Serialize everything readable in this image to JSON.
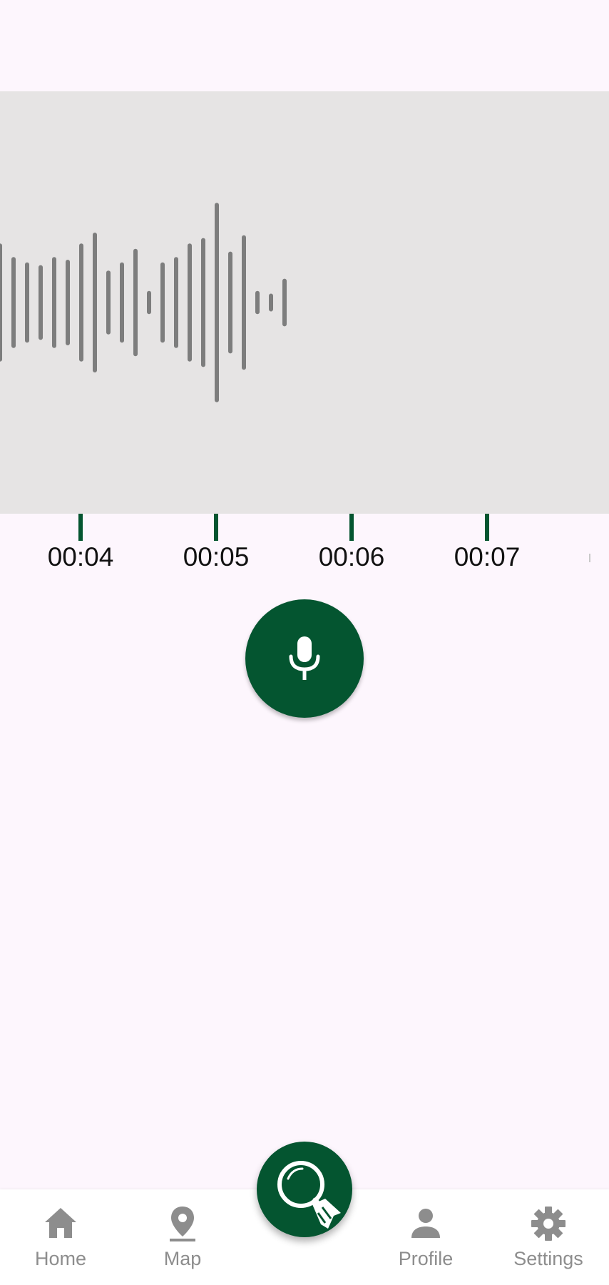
{
  "waveform": {
    "bar_color": "#7d7d7d",
    "background": "#e6e4e4",
    "amplitudes": [
      0.42,
      0.32,
      0.28,
      0.26,
      0.32,
      0.3,
      0.42,
      0.5,
      0.22,
      0.28,
      0.38,
      0.07,
      0.28,
      0.32,
      0.42,
      0.46,
      0.72,
      0.36,
      0.48,
      0.07,
      0.05,
      0.16
    ]
  },
  "timeline": {
    "accent": "#045530",
    "ticks": [
      {
        "label": "00:04"
      },
      {
        "label": "00:05"
      },
      {
        "label": "00:06"
      },
      {
        "label": "00:07"
      }
    ]
  },
  "record_button": {
    "icon": "microphone-icon",
    "color": "#045530"
  },
  "search_fab": {
    "icon": "magnifier-bird-icon",
    "color": "#045530"
  },
  "nav": {
    "items": [
      {
        "label": "Home",
        "icon": "home-icon"
      },
      {
        "label": "Map",
        "icon": "map-pin-icon"
      },
      {
        "label": "Profile",
        "icon": "person-icon"
      },
      {
        "label": "Settings",
        "icon": "gear-icon"
      }
    ],
    "inactive_color": "#8d8d8d"
  }
}
